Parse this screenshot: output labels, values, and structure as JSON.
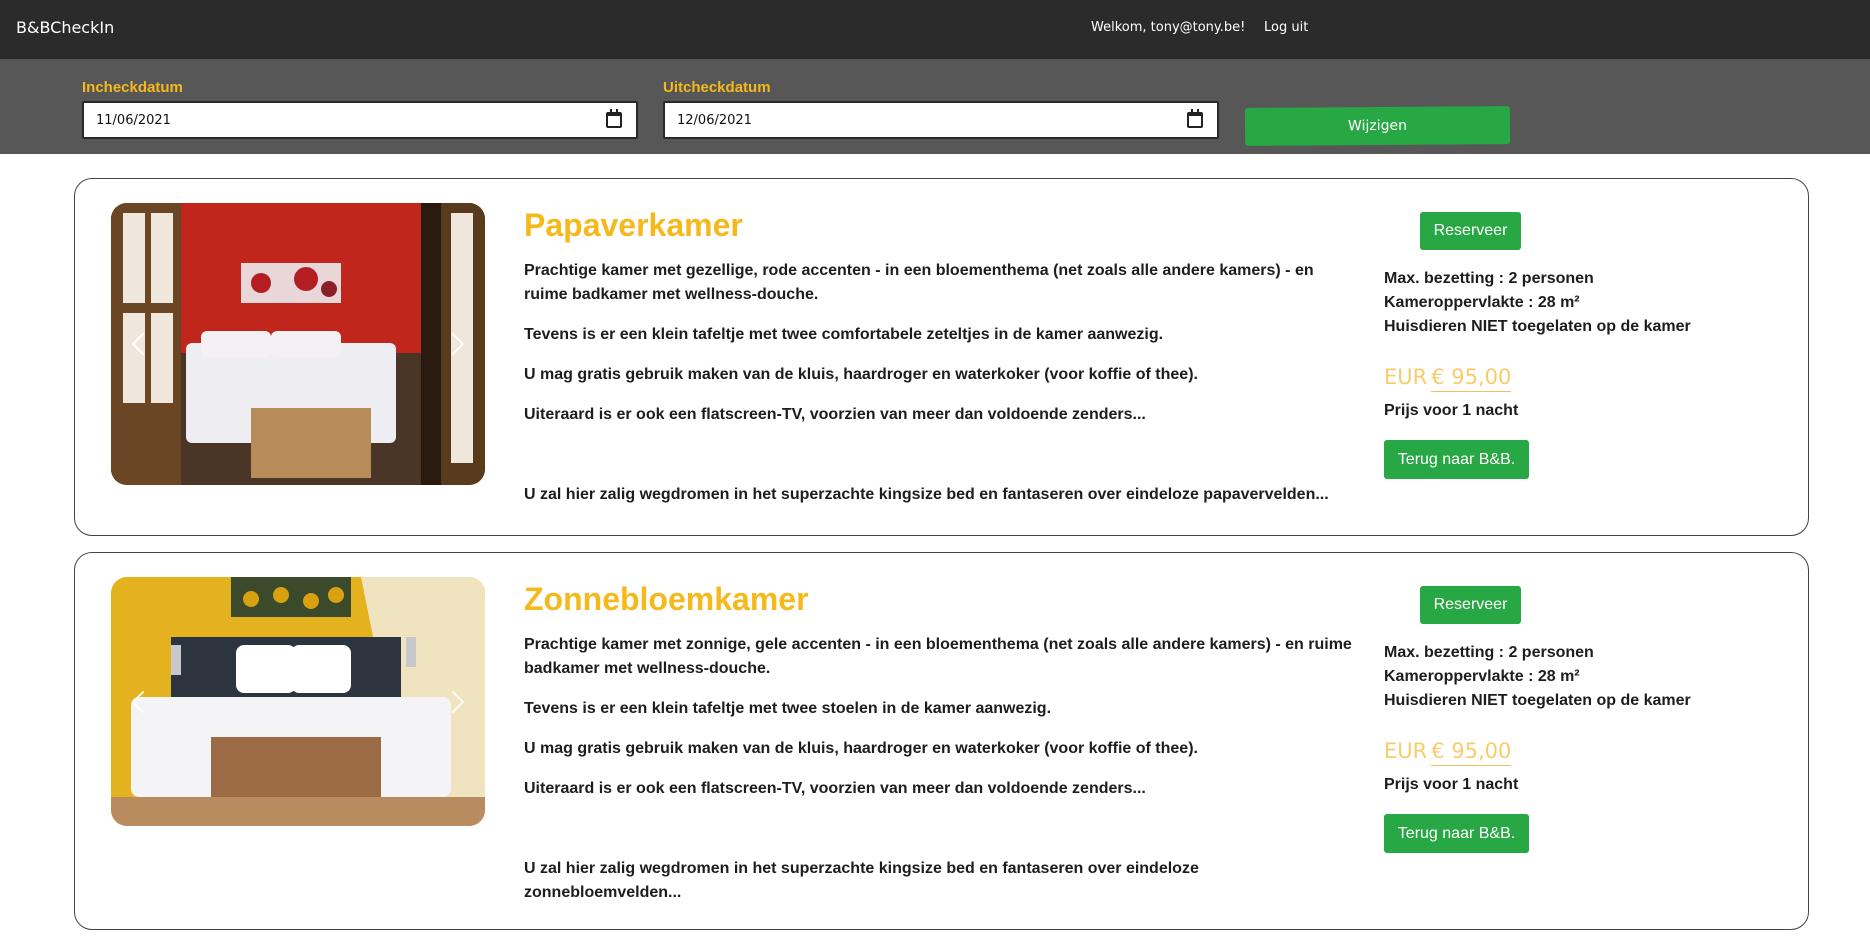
{
  "navbar": {
    "brand": "B&BCheckIn",
    "welcome": "Welkom, tony@tony.be!",
    "logout": "Log uit"
  },
  "dates": {
    "checkin_label": "Incheckdatum",
    "checkin_value": "11/06/2021",
    "checkout_label": "Uitcheckdatum",
    "checkout_value": "12/06/2021",
    "change_button": "Wijzigen"
  },
  "rooms": [
    {
      "title": "Papaverkamer",
      "desc1": "Prachtige kamer met gezellige, rode accenten - in een bloementhema (net zoals alle andere kamers) - en ruime badkamer met wellness-douche.",
      "desc2": "Tevens is er een klein tafeltje met twee comfortabele zeteltjes in de kamer aanwezig.",
      "desc3": "U mag gratis gebruik maken van de kluis, haardroger en waterkoker (voor koffie of thee).",
      "desc4": "Uiteraard is er ook een flatscreen-TV, voorzien van meer dan voldoende zenders...",
      "desc5": "U zal hier zalig wegdromen in het superzachte kingsize bed en fantaseren over eindeloze papavervelden...",
      "reserve": "Reserveer",
      "max_occupancy": "Max. bezetting : 2 personen",
      "area": "Kameroppervlakte : 28 m²",
      "pets": "Huisdieren NIET toegelaten op de kamer",
      "currency": "EUR",
      "price": "€ 95,00",
      "price_note": "Prijs voor 1 nacht",
      "back": "Terug naar B&B.",
      "colors": {
        "wall": "#c0261c",
        "accent": "#b31e22"
      }
    },
    {
      "title": "Zonnebloemkamer",
      "desc1": "Prachtige kamer met zonnige, gele accenten - in een bloementhema (net zoals alle andere kamers) - en ruime badkamer met wellness-douche.",
      "desc2": "Tevens is er een klein tafeltje met twee stoelen in de kamer aanwezig.",
      "desc3": "U mag gratis gebruik maken van de kluis, haardroger en waterkoker (voor koffie of thee).",
      "desc4": "Uiteraard is er ook een flatscreen-TV, voorzien van meer dan voldoende zenders...",
      "desc5": "U zal hier zalig wegdromen in het superzachte kingsize bed en fantaseren over eindeloze zonnebloemvelden...",
      "reserve": "Reserveer",
      "max_occupancy": "Max. bezetting : 2 personen",
      "area": "Kameroppervlakte : 28 m²",
      "pets": "Huisdieren NIET toegelaten op de kamer",
      "currency": "EUR",
      "price": "€ 95,00",
      "price_note": "Prijs voor 1 nacht",
      "back": "Terug naar B&B.",
      "colors": {
        "wall": "#e3b21e",
        "accent": "#d8a10f"
      }
    }
  ],
  "colors": {
    "navbar": "#2b2b2b",
    "datebar": "#575757",
    "accent_yellow": "#f6b91c",
    "button_green": "#28a745",
    "price": "#f6cd6b"
  }
}
